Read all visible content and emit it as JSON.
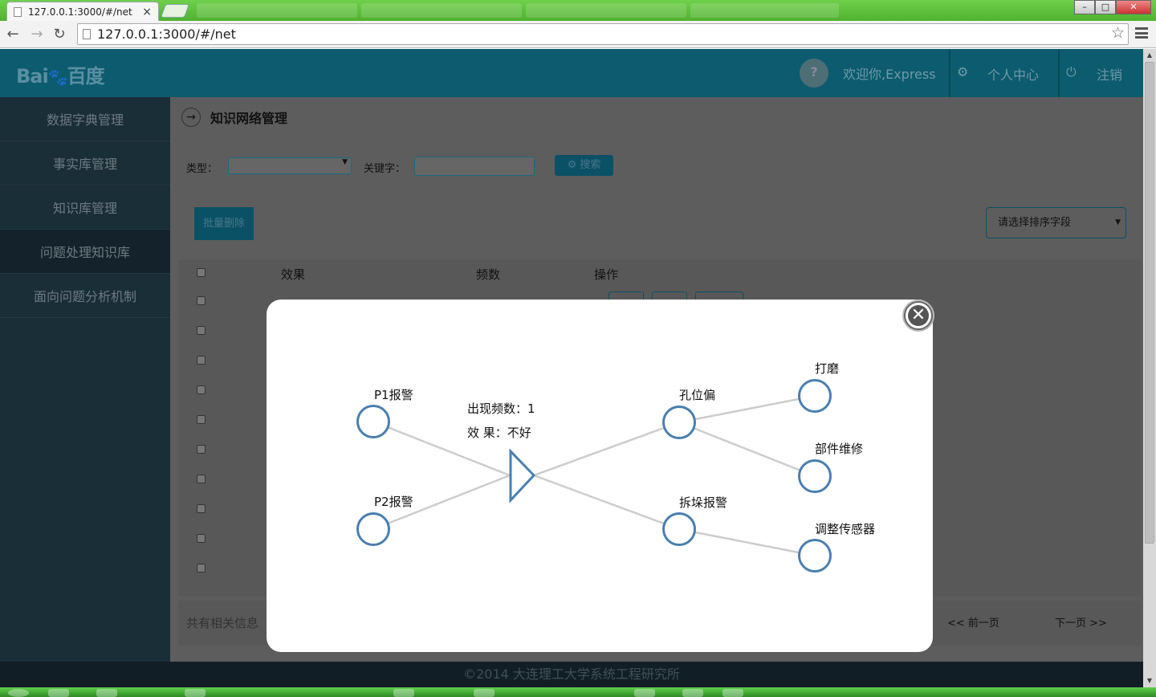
{
  "browser": {
    "tab_title": "127.0.0.1:3000/#/net",
    "tab_close": "×",
    "url": "127.0.0.1:3000/#/net",
    "win_min": "–",
    "win_max": "□",
    "win_close": "✕"
  },
  "header": {
    "logo": "Bai",
    "logo_paw": "🐾",
    "logo_cn": "百度",
    "avatar_text": "?",
    "welcome": "欢迎你,Express",
    "profile": "个人中心",
    "logout": "注销"
  },
  "sidebar": {
    "items": [
      {
        "label": "数据字典管理"
      },
      {
        "label": "事实库管理"
      },
      {
        "label": "知识库管理"
      },
      {
        "label": "问题处理知识库"
      },
      {
        "label": "面向问题分析机制"
      }
    ]
  },
  "main": {
    "page_title": "知识网络管理",
    "type_label": "类型：",
    "keyword_label": "关键字：",
    "search_label": "搜索",
    "batch_delete": "批量删除",
    "sort_placeholder": "请选择排序字段",
    "columns": [
      "效果",
      "频数",
      "操作"
    ],
    "total_text": "共有相关信息",
    "prev_page": "<< 前一页",
    "next_page": "下一页 >>"
  },
  "footer": {
    "copyright": "©2014 大连理工大学系统工程研究所"
  },
  "modal": {
    "nodes": {
      "p1": "P1报警",
      "p2": "P2报警",
      "hole": "孔位偏",
      "disassemble": "拆垛报警",
      "polish": "打磨",
      "repair": "部件维修",
      "sensor": "调整传感器"
    },
    "frequency": "出现频数：1",
    "effect": "效 果：不好",
    "colors": {
      "node_stroke": "#4a7fb0",
      "edge": "#cccccc"
    }
  }
}
